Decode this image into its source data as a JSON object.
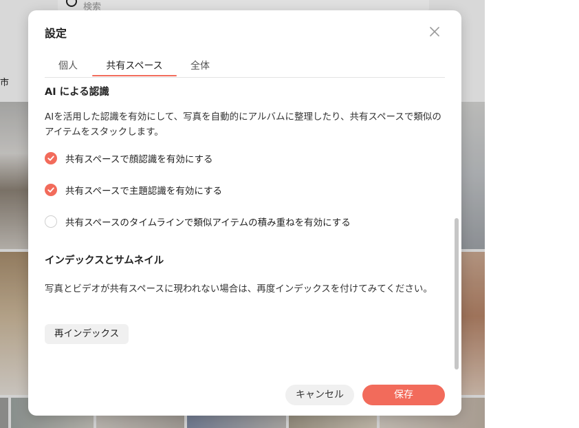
{
  "background": {
    "search_placeholder": "検索",
    "left_label": "市"
  },
  "dialog": {
    "title": "設定",
    "close_icon": "close-icon",
    "tabs": [
      {
        "label": "個人",
        "selected": false
      },
      {
        "label": "共有スペース",
        "selected": true
      },
      {
        "label": "全体",
        "selected": false
      }
    ],
    "ai_section": {
      "title": "AI による認識",
      "description": "AIを活用した認識を有効にして、写真を自動的にアルバムに整理したり、共有スペースで類似のアイテムをスタックします。",
      "options": [
        {
          "label": "共有スペースで顔認識を有効にする",
          "checked": true
        },
        {
          "label": "共有スペースで主題認識を有効にする",
          "checked": true
        },
        {
          "label": "共有スペースのタイムラインで類似アイテムの積み重ねを有効にする",
          "checked": false
        }
      ]
    },
    "index_section": {
      "title": "インデックスとサムネイル",
      "description": "写真とビデオが共有スペースに現われない場合は、再度インデックスを付けてみてください。",
      "reindex_label": "再インデックス"
    },
    "buttons": {
      "cancel": "キャンセル",
      "save": "保存"
    }
  },
  "colors": {
    "accent": "#f26b5b",
    "button_neutral": "#f0f0f0"
  }
}
